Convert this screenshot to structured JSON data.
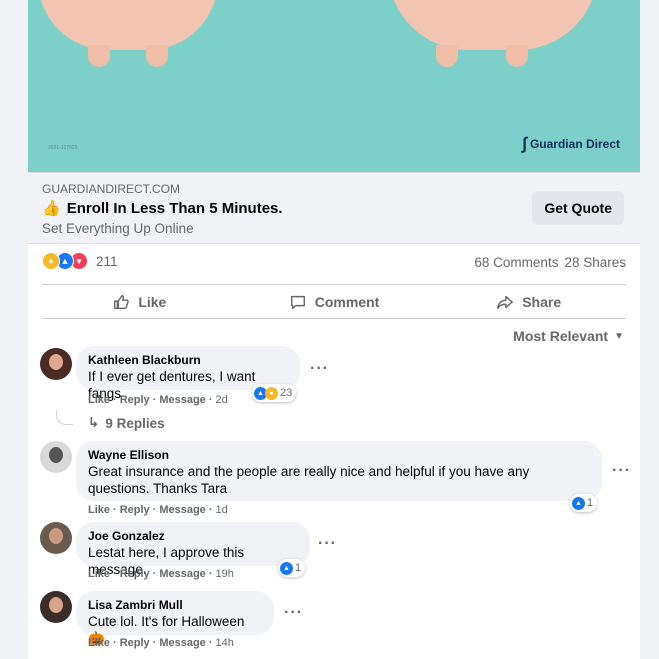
{
  "ad": {
    "code": "2021-127925",
    "brand": "Guardian Direct",
    "domain": "GUARDIANDIRECT.COM",
    "headline_emoji": "👍",
    "headline": "Enroll In Less Than 5 Minutes.",
    "subheadline": "Set Everything Up Online",
    "cta": "Get Quote"
  },
  "reactions": {
    "count": "211",
    "comments": "68 Comments",
    "shares": "28 Shares"
  },
  "actions": {
    "like": "Like",
    "comment": "Comment",
    "share": "Share"
  },
  "sort": {
    "label": "Most Relevant"
  },
  "comment_meta": {
    "like": "Like",
    "reply": "Reply",
    "message": "Message",
    "sep": "·"
  },
  "comments": [
    {
      "author": "Kathleen Blackburn",
      "text": "If I ever get dentures, I want fangs",
      "time": "2d",
      "reactions": "23",
      "replies": "9 Replies"
    },
    {
      "author": "Wayne Ellison",
      "text": "Great insurance and the people are really nice and helpful if you have any questions. Thanks Tara",
      "time": "1d",
      "reactions": "1"
    },
    {
      "author": "Joe Gonzalez",
      "text": "Lestat here, I approve this message.",
      "time": "19h",
      "reactions": "1"
    },
    {
      "author": "Lisa Zambri Mull",
      "text": "Cute lol. It's for Halloween 🎃",
      "time": "14h"
    }
  ],
  "colors": {
    "accent": "#1877f2",
    "image_bg": "#7cd0c9",
    "brand": "#152f5c"
  },
  "icons": [
    "thumbs-up-icon",
    "comment-icon",
    "share-icon",
    "dropdown-icon",
    "more-icon",
    "reply-arrow-icon"
  ]
}
